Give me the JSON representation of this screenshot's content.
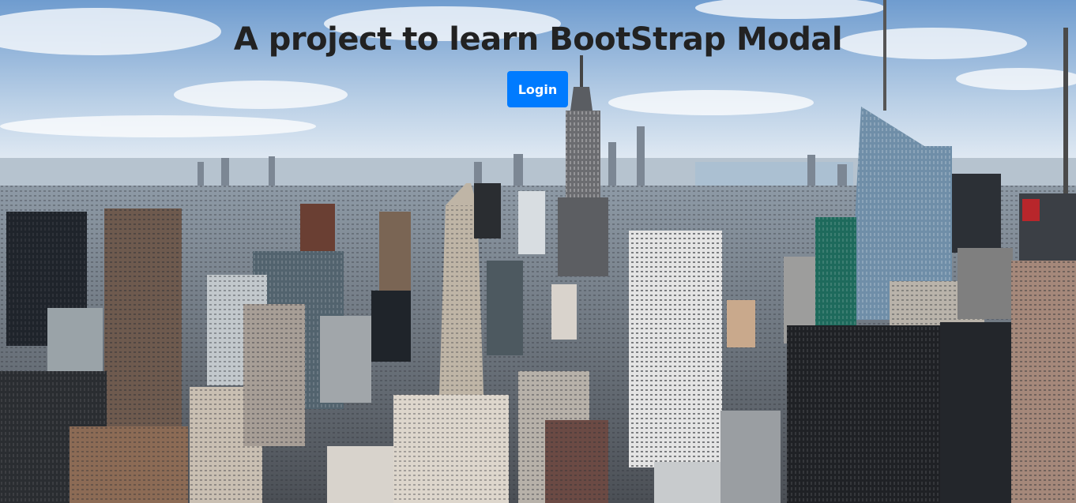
{
  "hero": {
    "title": "A project to learn BootStrap Modal",
    "background": "new-york-city-skyline-photo",
    "login_button": {
      "label": "Login",
      "color": "#007bff"
    }
  }
}
